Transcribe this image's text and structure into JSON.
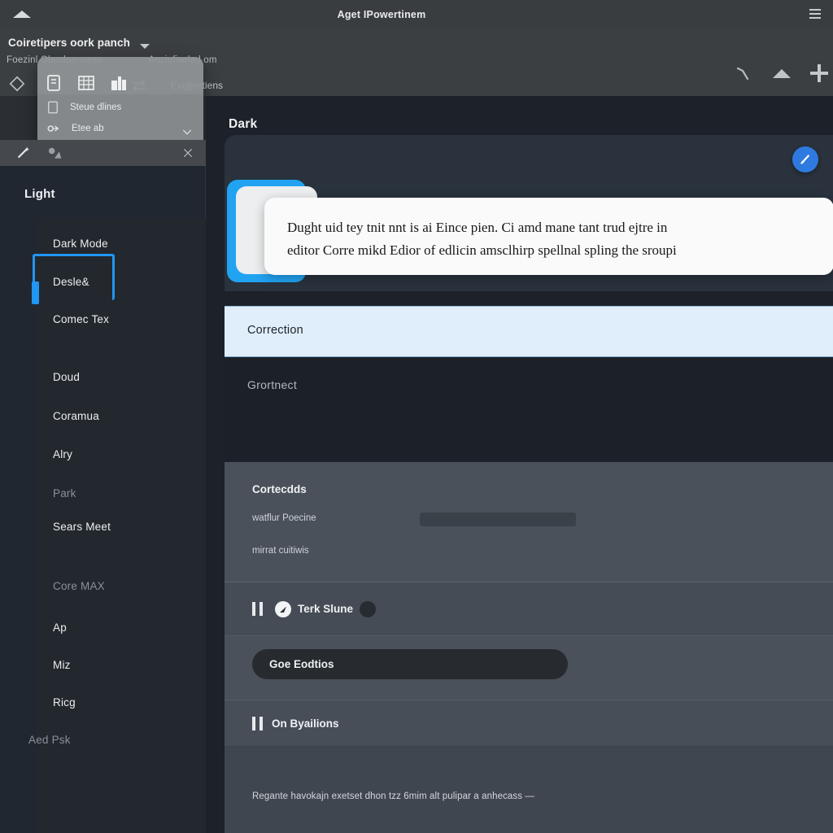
{
  "titlebar": {
    "title": "Aget IPowertinem",
    "collapse_icon": "chevron-up-icon",
    "menu_icon": "hamburger-icon"
  },
  "appbar": {
    "workspace_title": "Coiretipers oork panch",
    "caret_icon": "chevron-down-icon",
    "tabs": [
      {
        "label": "Foezinl Olaxdaenoeso"
      },
      {
        "label": "Anziufiwrled om"
      }
    ],
    "left_icon": "diamond-icon",
    "secondary_icons": [
      {
        "name": "swap-icon"
      }
    ],
    "extensions_label": "Exgjjectiens",
    "top_right_icons": [
      {
        "name": "wrench-icon"
      },
      {
        "name": "triangle-up-icon"
      },
      {
        "name": "plus-icon"
      }
    ]
  },
  "popover": {
    "icons": [
      {
        "name": "note-icon"
      },
      {
        "name": "table-icon"
      },
      {
        "name": "building-icon"
      }
    ],
    "items": [
      {
        "label": "Steue dlines",
        "icon": "document-icon"
      },
      {
        "label": "Etee ab",
        "icon": "link-icon"
      }
    ],
    "expand_icon": "chevron-down-icon"
  },
  "strip_toolbar": {
    "icons": [
      {
        "name": "magic-wand-icon"
      },
      {
        "name": "shapes-icon"
      }
    ],
    "close_icon": "close-icon"
  },
  "sidebar": {
    "heading": "Light",
    "items": [
      {
        "label": "Dark Mode",
        "dim": false
      },
      {
        "label": "Desle&",
        "dim": false
      },
      {
        "label": "Comec Tex",
        "dim": false
      },
      {
        "label": "Doud",
        "dim": false
      },
      {
        "label": "Coramua",
        "dim": false
      },
      {
        "label": "Alry",
        "dim": false
      },
      {
        "label": "Park",
        "dim": true
      },
      {
        "label": "Sears Meet",
        "dim": false
      },
      {
        "label": "Core MAX",
        "dim": true,
        "selected": true
      },
      {
        "label": "Ap",
        "dim": false
      },
      {
        "label": "Miz",
        "dim": false
      },
      {
        "label": "Ricg",
        "dim": false
      },
      {
        "label": "Aed Psk",
        "dim": true
      }
    ],
    "accent_color": "#2196f3"
  },
  "main": {
    "heading": "Dark",
    "fab_icon": "pen-icon",
    "fab_color": "#2e7ae0",
    "card": {
      "line1": "Dught uid tey tnit nnt is ai Eince pien.  Ci amd mane tant  trud ejtre in",
      "line2": "editor Corre mikd Edior of edlicin amsclhirp spellnal spling the sroupi"
    },
    "correction_bar": {
      "label": "Correction",
      "background": "#e0eefb"
    },
    "dark_section": {
      "label": "Grortnect"
    },
    "gray_section": {
      "title": "Cortecdds",
      "rows": [
        {
          "label": "watflur Poecine",
          "has_bar": true
        },
        {
          "label": "mirrat cuitiwis",
          "has_bar": false
        }
      ]
    },
    "play_row": {
      "pause_icon": "pause-icon",
      "status_icon": "arrow-circle-icon",
      "label": "Terk Slune",
      "trailing_icon": "dot-icon"
    },
    "input_row": {
      "value": "Goe Eodtios",
      "placeholder": "Goe Eodtios"
    },
    "option_row": {
      "pause_icon": "pause-icon",
      "label": "On Byailions"
    },
    "footer": {
      "note": "Regante havokajn exetset dhon tzz 6mim alt pulipar a anhecass —"
    }
  }
}
